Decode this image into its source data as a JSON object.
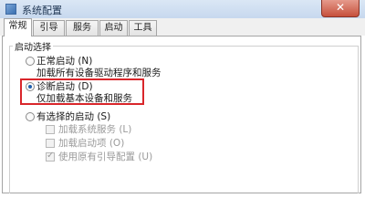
{
  "window": {
    "title": "系统配置",
    "close_glyph": "✕"
  },
  "tabs": [
    {
      "label": "常规",
      "active": true
    },
    {
      "label": "引导",
      "active": false
    },
    {
      "label": "服务",
      "active": false
    },
    {
      "label": "启动",
      "active": false
    },
    {
      "label": "工具",
      "active": false
    }
  ],
  "startup_selection": {
    "title": "启动选择",
    "options": [
      {
        "label": "正常启动 (N)",
        "description": "加载所有设备驱动程序和服务",
        "checked": false
      },
      {
        "label": "诊断启动 (D)",
        "description": "仅加载基本设备和服务",
        "checked": true
      },
      {
        "label": "有选择的启动 (S)",
        "checked": false
      }
    ],
    "selective_items": [
      {
        "label": "加载系统服务 (L)",
        "checked": false,
        "enabled": false
      },
      {
        "label": "加载启动项 (O)",
        "checked": false,
        "enabled": false
      },
      {
        "label": "使用原有引导配置 (U)",
        "checked": true,
        "enabled": false
      }
    ]
  },
  "colors": {
    "highlight": "#d9262b",
    "radio_dot": "#1f5fae",
    "disabled_text": "#9a9a9a"
  }
}
